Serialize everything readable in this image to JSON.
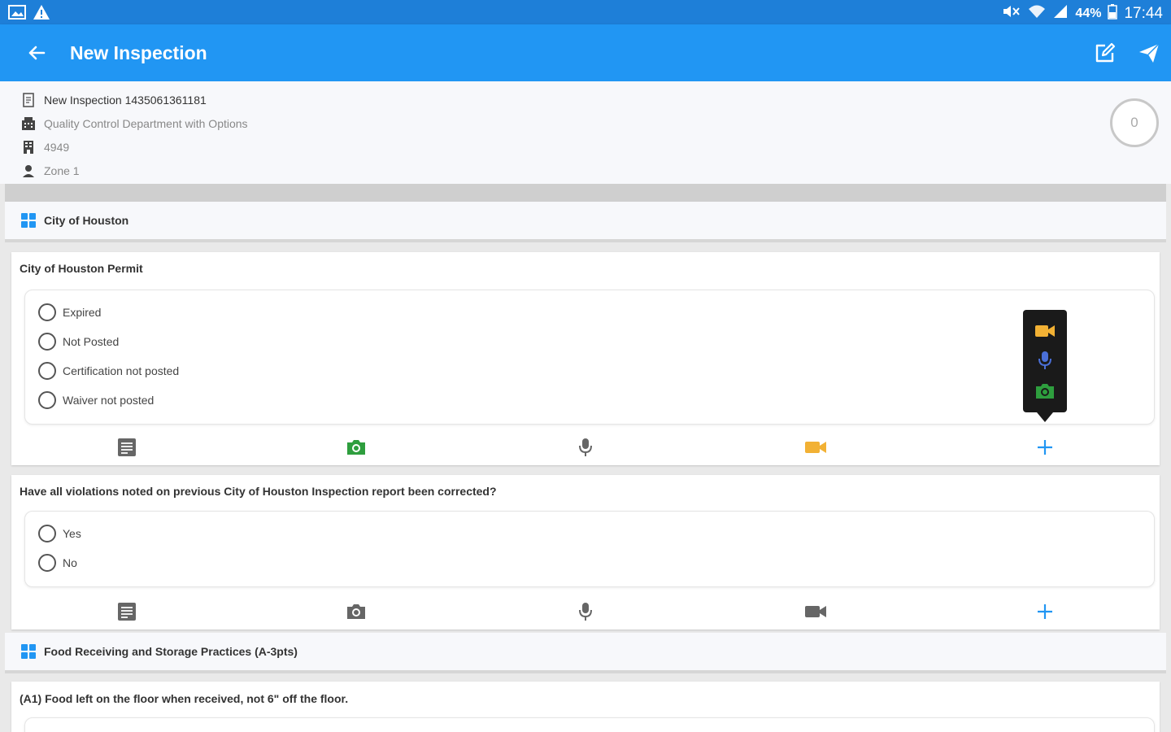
{
  "status_bar": {
    "battery_percent": "44%",
    "time": "17:44",
    "icons": [
      "gallery-icon",
      "warning-icon",
      "mute-icon",
      "wifi-icon",
      "signal-icon",
      "battery-icon"
    ]
  },
  "toolbar": {
    "title": "New Inspection",
    "icons": [
      "back-arrow-icon",
      "edit-icon",
      "send-icon"
    ]
  },
  "inspection": {
    "name": "New Inspection 1435061361181",
    "department": "Quality Control Department with Options",
    "number": "4949",
    "zone": "Zone 1",
    "score": "0"
  },
  "sections": [
    {
      "title": "City of Houston",
      "questions": [
        {
          "title": "City of Houston Permit",
          "options": [
            "Expired",
            "Not Posted",
            "Certification not posted",
            "Waiver not posted"
          ]
        },
        {
          "title": "Have all violations noted on previous City of Houston Inspection report been corrected?",
          "options": [
            "Yes",
            "No"
          ]
        }
      ]
    },
    {
      "title": "Food Receiving and Storage Practices (A-3pts)",
      "questions": [
        {
          "title": "(A1) Food left on the floor when received, not 6\" off the floor."
        }
      ]
    }
  ],
  "colors": {
    "status_bar": "#1e7fd8",
    "toolbar": "#2196f3",
    "accent_blue": "#2196f3",
    "camera_green": "#2e9e3e",
    "video_orange": "#f2b134",
    "mic_blue": "#4a6fd8",
    "icon_gray": "#666666"
  }
}
